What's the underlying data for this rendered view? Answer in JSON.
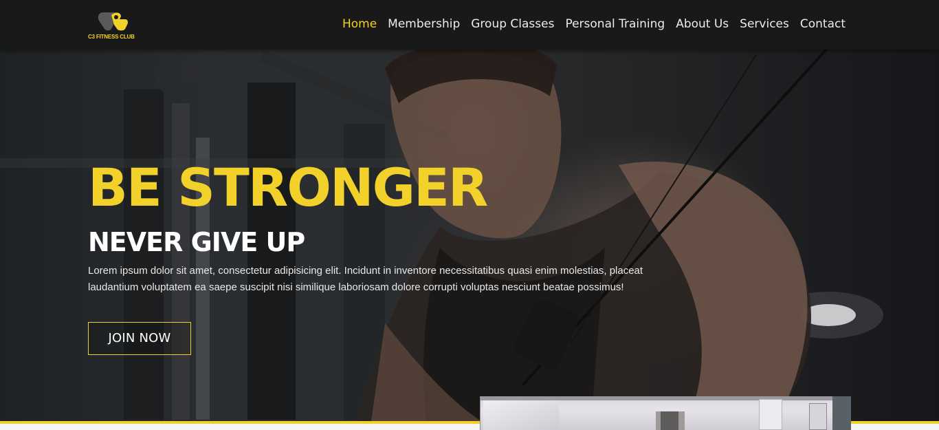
{
  "brand": {
    "logo_text": "C3 FITNESS CLUB",
    "logo_icon": "kettlebell-icon",
    "accent_color": "#f2d22a"
  },
  "nav": {
    "active": "Home",
    "items": [
      {
        "label": "Home"
      },
      {
        "label": "Membership"
      },
      {
        "label": "Group Classes"
      },
      {
        "label": "Personal Training"
      },
      {
        "label": "About Us"
      },
      {
        "label": "Services"
      },
      {
        "label": "Contact"
      }
    ]
  },
  "hero": {
    "headline": "BE STRONGER",
    "subheadline": "NEVER GIVE UP",
    "description": "Lorem ipsum dolor sit amet, consectetur adipisicing elit. Incidunt in inventore necessitatibus quasi enim molestias, placeat laudantium voluptatem ea saepe suscipit nisi similique laboriosam dolore corrupti voluptas nesciunt beatae possimus!",
    "cta_label": "JOIN NOW",
    "background": "gym-photo"
  }
}
